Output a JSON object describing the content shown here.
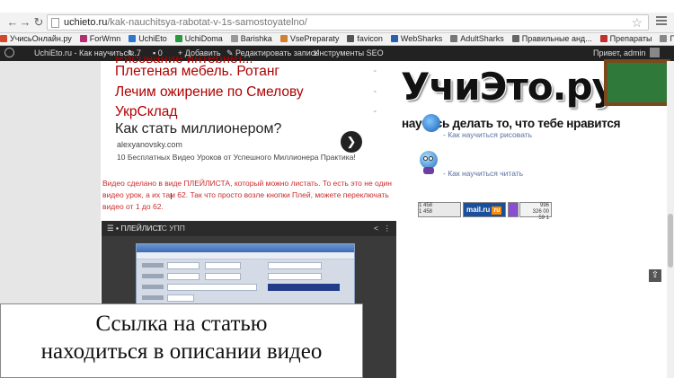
{
  "browser": {
    "address": {
      "host": "uchieto.ru",
      "path": "/kak-nauchitsya-rabotat-v-1s-samostoyatelno/"
    },
    "bookmarks": [
      {
        "label": "УчисьОнлайн.ру",
        "color": "#d04a2a"
      },
      {
        "label": "ForWmn",
        "color": "#b03070"
      },
      {
        "label": "UchiEto",
        "color": "#2a7ad0"
      },
      {
        "label": "UchiDoma",
        "color": "#2a9a40"
      },
      {
        "label": "Barishka",
        "color": "#999999"
      },
      {
        "label": "VsePreparaty",
        "color": "#d08030"
      },
      {
        "label": "favicon",
        "color": "#555555"
      },
      {
        "label": "WebSharks",
        "color": "#2a60b0"
      },
      {
        "label": "AdultSharks",
        "color": "#777777"
      },
      {
        "label": "Правильные анд...",
        "color": "#666666"
      },
      {
        "label": "Препараты",
        "color": "#c03030"
      },
      {
        "label": "Препараты от Мар...",
        "color": "#888888"
      }
    ]
  },
  "wpbar": {
    "site_name": "UchiEto.ru - Как научиться...",
    "updates": "7",
    "comments": "0",
    "new_label": "+ Добавить",
    "edit_label": "Редактировать запись",
    "seo_label": "Инструменты SEO",
    "greeting": "Привет, admin"
  },
  "ads": {
    "cut_text": "Рисование интернет...",
    "links": [
      "Плетеная мебель. Ротанг",
      "Лечим ожирение по Смелову",
      "УкрСклад"
    ],
    "dash": "-",
    "millionaire": {
      "title": "Как стать миллионером?",
      "url": "alexyanovsky.com",
      "desc": "10 Бесплатных Видео Уроков от Успешного Миллионера Практика!"
    }
  },
  "content": {
    "red_text": "Видео сделано в виде ПЛЕЙЛИСТА, который можно листать. То есть это не один видео урок, а их там 62. Так что просто возле кнопки Плей, можете переключать видео от 1 до 62.",
    "caret": "I"
  },
  "player": {
    "playlist_label": "☰ ▪ ПЛЕЙЛИСТ",
    "channel_title": "1С УПП",
    "share_icon": "share-icon",
    "more_icon": "more-icon"
  },
  "sidebar": {
    "logo_text": "УчиЭто.ру",
    "slogan": "научись делать то, что тебе нравится",
    "link1": "- Как научиться рисовать",
    "link2": "- Как научиться читать",
    "counter_mail": "mail.ru",
    "counter_mail_ru": "ru",
    "counter_top_lines": [
      "1 458",
      "1 458"
    ],
    "counter_right_lines": [
      "996",
      "326 00",
      "59 1"
    ]
  },
  "caption": {
    "line1": "Ссылка на статью",
    "line2": "находиться в описании видео"
  },
  "colors": {
    "ad_red": "#b00000",
    "body_red": "#cc2b2b",
    "wp_bar": "#222222"
  }
}
